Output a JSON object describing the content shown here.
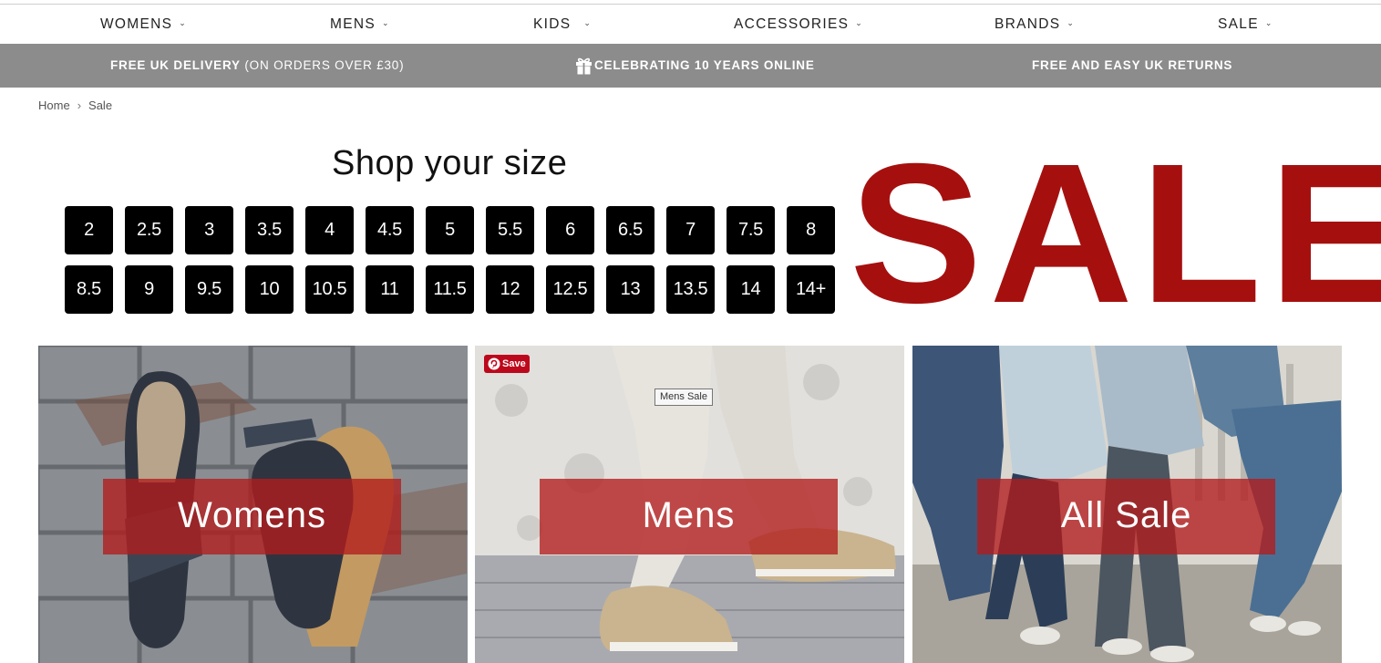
{
  "nav": {
    "items": [
      {
        "label": "WOMENS"
      },
      {
        "label": "MENS"
      },
      {
        "label": "KIDS"
      },
      {
        "label": "ACCESSORIES"
      },
      {
        "label": "BRANDS"
      },
      {
        "label": "SALE"
      }
    ]
  },
  "promo": {
    "delivery_bold": "FREE UK DELIVERY",
    "delivery_light": " (ON ORDERS OVER £30)",
    "celebrating": "CELEBRATING 10 YEARS ONLINE",
    "returns": "FREE AND EASY UK RETURNS",
    "gift_icon": "gift-icon"
  },
  "breadcrumb": {
    "home": "Home",
    "separator": "›",
    "current": "Sale"
  },
  "sizes": {
    "title": "Shop your size",
    "row1": [
      "2",
      "2.5",
      "3",
      "3.5",
      "4",
      "4.5",
      "5",
      "5.5",
      "6",
      "6.5",
      "7",
      "7.5",
      "8"
    ],
    "row2": [
      "8.5",
      "9",
      "9.5",
      "10",
      "10.5",
      "11",
      "11.5",
      "12",
      "12.5",
      "13",
      "13.5",
      "14",
      "14+"
    ]
  },
  "sale_banner": {
    "text": "SALE",
    "color": "#a5100f"
  },
  "tiles": [
    {
      "label": "Womens"
    },
    {
      "label": "Mens",
      "pin_save": "Save",
      "tooltip": "Mens Sale"
    },
    {
      "label": "All Sale"
    }
  ],
  "colors": {
    "promo_bar": "#8c8c8c",
    "label_box": "#b21c1c",
    "pinterest": "#bd081c"
  }
}
